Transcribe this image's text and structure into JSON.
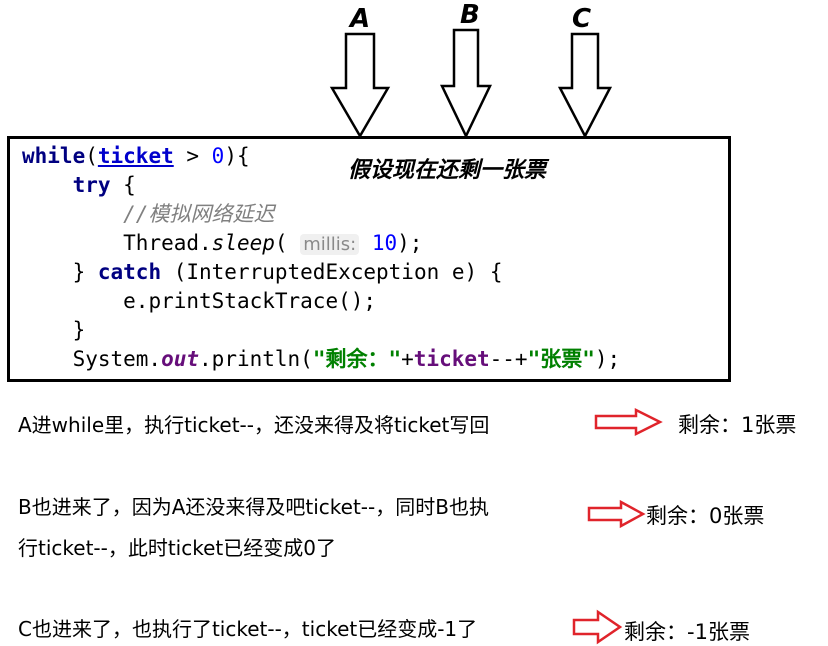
{
  "threads": {
    "a": "A",
    "b": "B",
    "c": "C"
  },
  "code": {
    "while_kw": "while",
    "ticket": "ticket",
    "cond_rest": " > ",
    "zero": "0",
    "cond_close": "){",
    "try_kw": "try",
    "brace_open": " {",
    "comment": "//模拟网络延迟",
    "thread_prefix": "Thread.",
    "sleep": "sleep",
    "paren_open": "( ",
    "hint": "millis:",
    "ten": "10",
    "paren_close": ");",
    "close_brace": "} ",
    "catch_kw": "catch",
    "catch_rest": " (InterruptedException e) {",
    "print_trace": "e.printStackTrace();",
    "brace_close": "}",
    "system_prefix": "System.",
    "out": "out",
    "println_open": ".println(",
    "str_remain": "\"剩余：\"",
    "plus1": "+",
    "ticket2": "ticket",
    "decrement": "--+",
    "str_ticket": "\"张票\"",
    "end": ");"
  },
  "note": "假设现在还剩一张票",
  "steps": {
    "step1": "A进while里，执行ticket--，还没来得及将ticket写回",
    "result1": "剩余：1张票",
    "step2_line1": "B也进来了，因为A还没来得及吧ticket--，同时B也执",
    "step2_line2": "行ticket--，此时ticket已经变成0了",
    "result2": "剩余：0张票",
    "step3": "C也进来了，也执行了ticket--，ticket已经变成-1了",
    "result3": "剩余：-1张票"
  },
  "colors": {
    "arrow_red": "#e0242b",
    "keyword": "#000080",
    "field": "#660e7a",
    "string": "#008000",
    "number": "#0000ff",
    "comment": "#808080"
  }
}
